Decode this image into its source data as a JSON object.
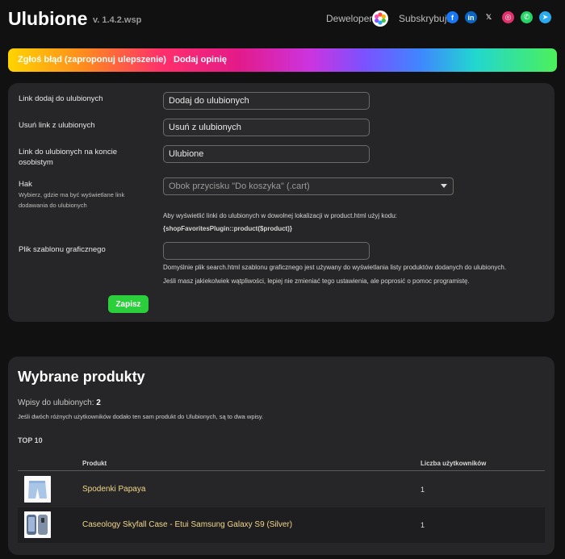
{
  "header": {
    "title": "Ulubione",
    "version": "v. 1.4.2.wsp",
    "developer_label": "Deweloper:",
    "subscribe_label": "Subskrybuj:",
    "social": [
      {
        "name": "facebook-icon",
        "glyph": "f",
        "color": "#1877f2"
      },
      {
        "name": "linkedin-icon",
        "glyph": "in",
        "color": "#0a66c2"
      },
      {
        "name": "x-icon",
        "glyph": "𝕏",
        "color": "#111112"
      },
      {
        "name": "instagram-icon",
        "glyph": "◎",
        "color": "#e1306c"
      },
      {
        "name": "whatsapp-icon",
        "glyph": "✆",
        "color": "#25d366"
      },
      {
        "name": "telegram-icon",
        "glyph": "➤",
        "color": "#2aabee"
      }
    ]
  },
  "banner": {
    "report_bug": "Zgłoś błąd (zaproponuj ulepszenie)",
    "add_review": "Dodaj opinię"
  },
  "settings": {
    "add_link_label": "Link dodaj do ulubionych",
    "add_link_value": "Dodaj do ulubionych",
    "remove_link_label": "Usuń link z ulubionych",
    "remove_link_value": "Usuń z ulubionych",
    "account_link_label": "Link do ulubionych na koncie osobistym",
    "account_link_value": "Ulubione",
    "hook_label": "Hak",
    "hook_hint": "Wybierz, gdzie ma być wyświetlane link dodawania do ulubionych",
    "hook_selected": "Obok przycisku \"Do koszyka\" (.cart)",
    "hook_note": "Aby wyświetlić linki do ulubionych w dowolnej lokalizacji w product.html użyj kodu:",
    "hook_code": "{shopFavoritesPlugin::product($product)}",
    "template_label": "Plik szablonu graficznego",
    "template_value": "",
    "template_note_1": "Domyślnie plik search.html szablonu graficznego jest używany do wyświetlania listy produktów dodanych do ulubionych.",
    "template_note_2": "Jeśli masz jakiekolwiek wątpliwości, lepiej nie zmieniać tego ustawienia, ale poprosić o pomoc programistę.",
    "save_label": "Zapisz"
  },
  "products": {
    "heading": "Wybrane produkty",
    "entries_label": "Wpisy do ulubionych:",
    "entries_count": "2",
    "description": "Jeśli dwóch różnych użytkowników dodało ten sam produkt do Ulubionych, są to dwa wpisy.",
    "top_label": "TOP 10",
    "columns": [
      "Produkt",
      "Liczba użytkowników"
    ],
    "rows": [
      {
        "name": "Spodenki Papaya",
        "users": "1"
      },
      {
        "name": "Caseology Skyfall Case - Etui Samsung Galaxy S9 (Silver)",
        "users": "1"
      }
    ]
  }
}
